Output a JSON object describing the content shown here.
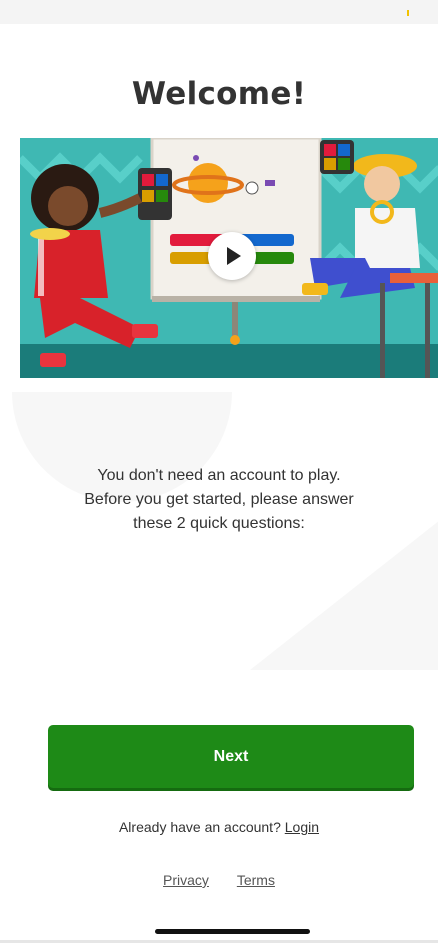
{
  "title": "Welcome!",
  "video": {
    "play_icon": "play-icon"
  },
  "intro": {
    "line1": "You don't need an account to play.",
    "line2": "Before you get started, please answer",
    "line3": "these 2 quick questions:"
  },
  "next_button": {
    "label": "Next"
  },
  "login": {
    "prompt": "Already have an account?",
    "link": "Login"
  },
  "footer": {
    "privacy": "Privacy",
    "terms": "Terms"
  },
  "colors": {
    "primary_button": "#1e8a17",
    "illustration_bg": "#3fb8b3"
  }
}
